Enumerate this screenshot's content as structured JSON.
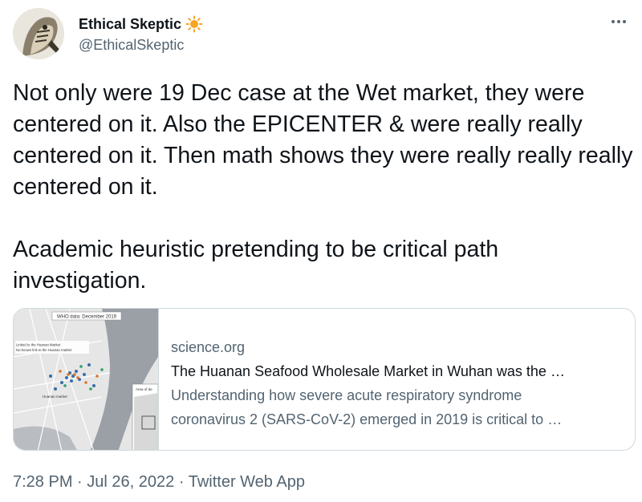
{
  "author": {
    "display_name": "Ethical Skeptic",
    "handle": "@EthicalSkeptic",
    "avatar_icon": "profile-avatar",
    "badge_icon": "sun-emoji-icon",
    "badge_color": "#f5a623"
  },
  "menu_icon": "more-options-icon",
  "tweet": {
    "text": "Not only were 19 Dec case at the Wet market, they were centered on it. Also the EPICENTER & were really really centered on it. Then math shows they were really really really centered on it.\n\nAcademic heuristic pretending to be critical path investigation."
  },
  "link_card": {
    "thumbnail": {
      "title": "WHO data: December 2019",
      "legend_1": "Linked to the Huanan Market",
      "legend_2": "No known link to the Huanan market",
      "market_label": "Huanan market",
      "inset_label": "Area of de"
    },
    "domain": "science.org",
    "title": "The Huanan Seafood Wholesale Market in Wuhan was the …",
    "description_line_1": "Understanding how severe acute respiratory syndrome",
    "description_line_2": "coronavirus 2 (SARS-CoV-2) emerged in 2019 is critical to …"
  },
  "meta": {
    "time": "7:28 PM",
    "separator": "·",
    "date": "Jul 26, 2022",
    "source": "Twitter Web App"
  },
  "colors": {
    "text": "#0f1419",
    "secondary": "#536471",
    "border": "#cfd9de"
  }
}
